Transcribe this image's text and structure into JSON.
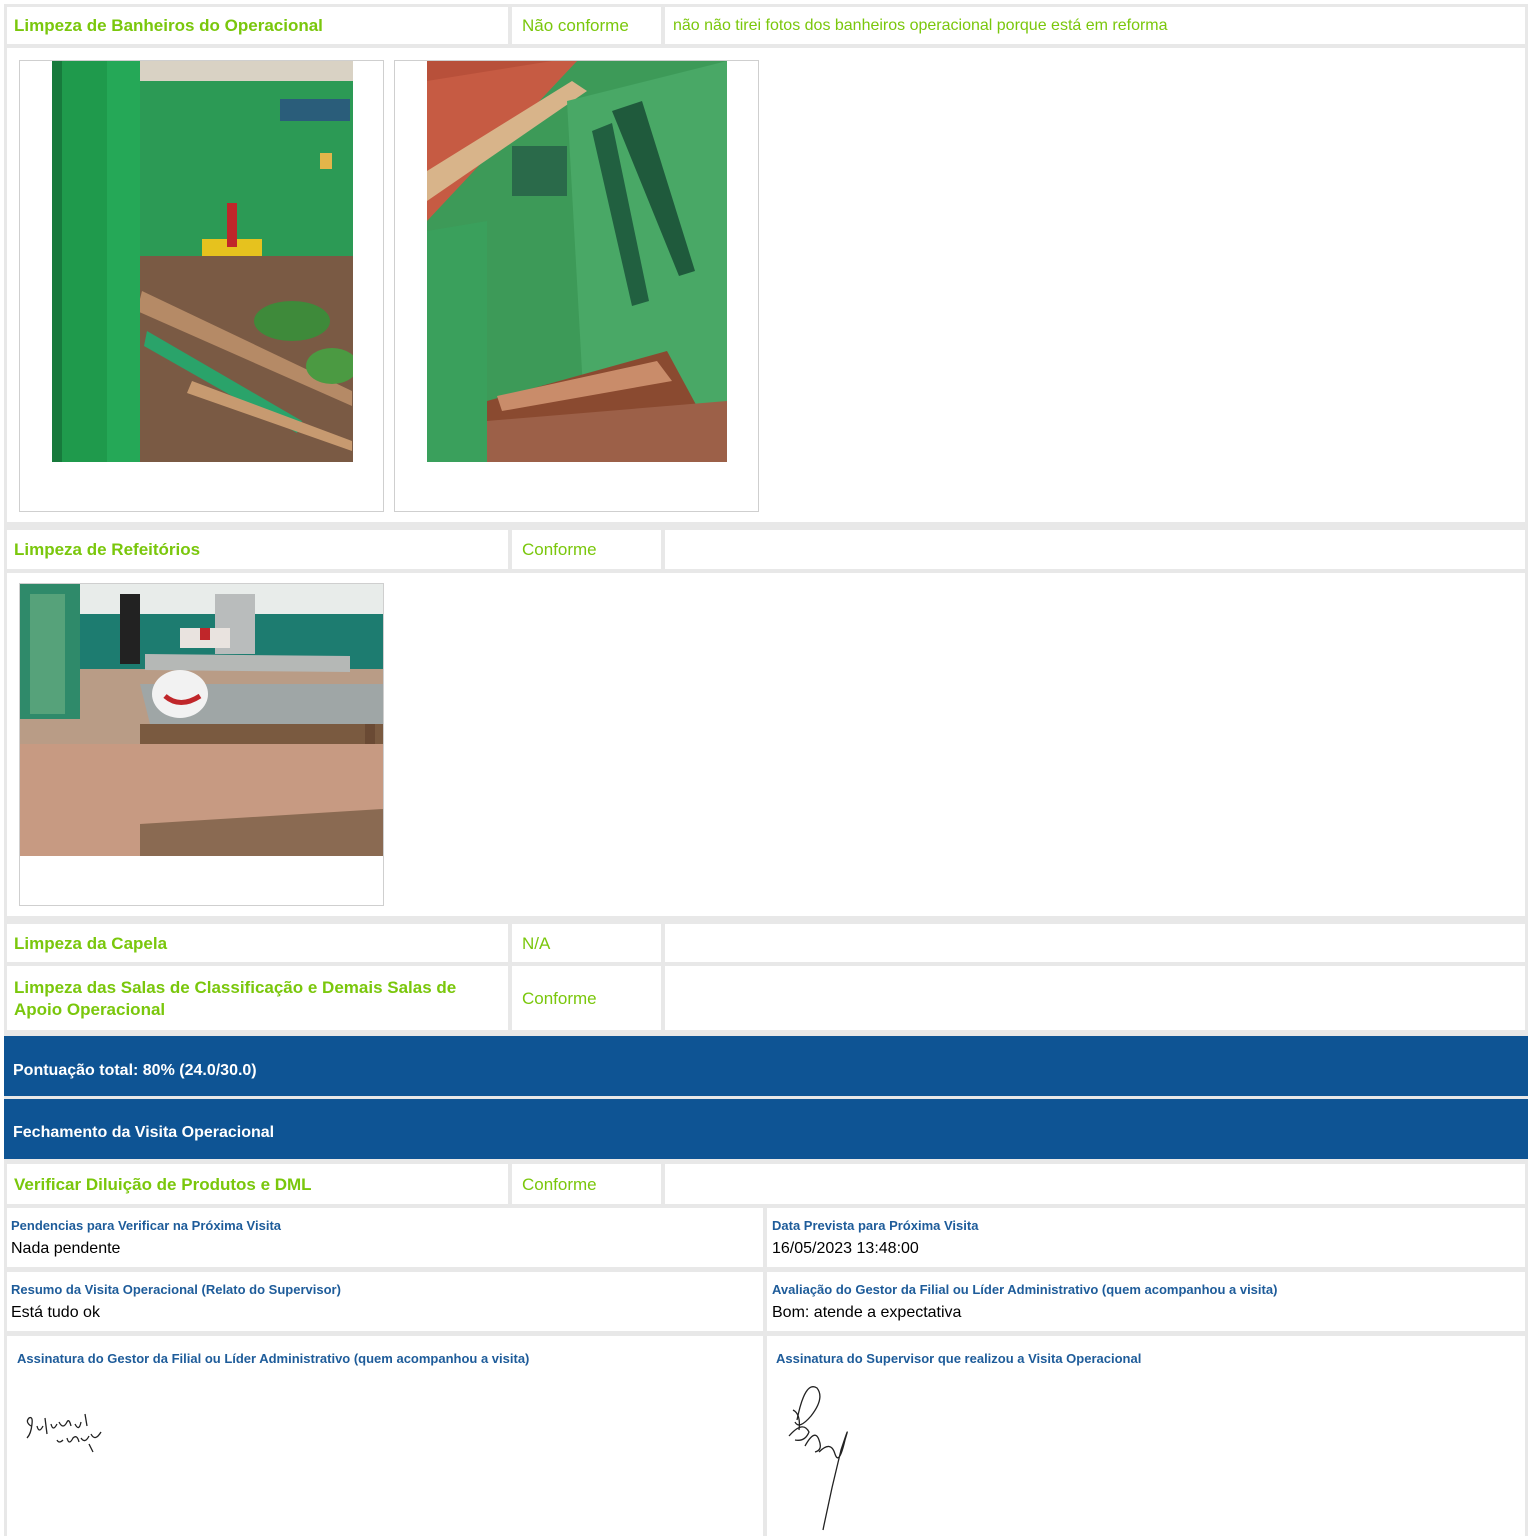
{
  "sections": [
    {
      "title": "Limpeza de Banheiros do Operacional",
      "status": "Não conforme",
      "comment": "não não tirei fotos dos banheiros operacional porque está em reforma"
    },
    {
      "title": "Limpeza de Refeitórios",
      "status": "Conforme",
      "comment": ""
    },
    {
      "title": "Limpeza da Capela",
      "status": "N/A",
      "comment": ""
    },
    {
      "title": "Limpeza das Salas de Classificação e Demais Salas de Apoio Operacional",
      "status": "Conforme",
      "comment": ""
    }
  ],
  "score_bar": {
    "label": "Pontuação total: 80% (24.0/30.0)"
  },
  "closing_bar": {
    "label": "Fechamento da Visita Operacional"
  },
  "closing_item": {
    "title": "Verificar Diluição de Produtos e DML",
    "status": "Conforme",
    "comment": ""
  },
  "fields": {
    "pending_label": "Pendencias para Verificar na Próxima Visita",
    "pending_value": "Nada pendente",
    "next_visit_label": "Data Prevista para Próxima Visita",
    "next_visit_value": "16/05/2023 13:48:00",
    "summary_label": "Resumo da Visita Operacional (Relato do Supervisor)",
    "summary_value": "Está tudo ok",
    "evaluation_label": "Avaliação do Gestor da Filial ou Líder Administrativo (quem acompanhou a visita)",
    "evaluation_value": "Bom: atende a expectativa"
  },
  "signatures": {
    "manager_label": "Assinatura do Gestor da Filial ou Líder Administrativo (quem acompanhou a visita)",
    "manager_signature_text": "Sulvani Lopes",
    "supervisor_label": "Assinatura do Supervisor que realizou a Visita Operacional"
  },
  "colors": {
    "accent_green": "#7ac70c",
    "header_blue": "#0e5494",
    "label_blue": "#1e5c9a",
    "grid_gray": "#e8e8e8"
  }
}
